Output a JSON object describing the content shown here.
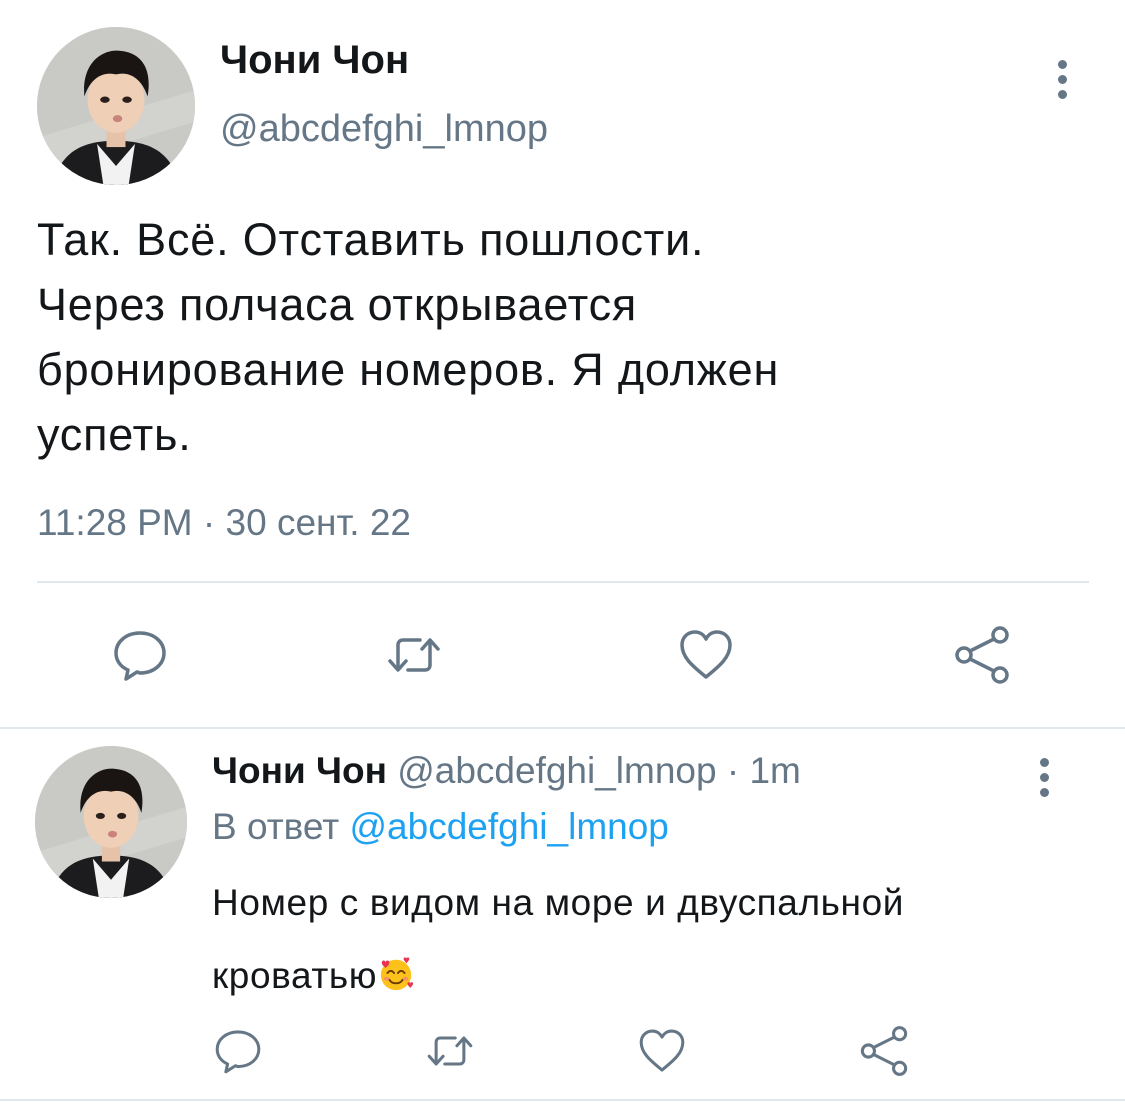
{
  "main_tweet": {
    "name": "Чони Чон",
    "handle": "@abcdefghi_lmnop",
    "text": "Так. Всё. Отставить пошлости.\nЧерез полчаса открывается\nбронирование номеров. Я должен\nуспеть.",
    "timestamp": "11:28 PM · 30 сент. 22",
    "icons": {
      "avatar": "profile-photo",
      "more": "more-vertical-icon",
      "reply": "reply-icon",
      "retweet": "retweet-icon",
      "like": "heart-icon",
      "share": "share-icon"
    }
  },
  "reply_tweet": {
    "name": "Чони Чон",
    "handle": "@abcdefghi_lmnop",
    "separator": "·",
    "time_ago": "1m",
    "reply_to_label": "В ответ",
    "reply_to_handle": "@abcdefghi_lmnop",
    "text": "Номер с видом на море и двуспальной кроватью",
    "emoji": "smiling-face-with-hearts",
    "icons": {
      "avatar": "profile-photo",
      "more": "more-vertical-icon",
      "reply": "reply-icon",
      "retweet": "retweet-icon",
      "like": "heart-icon",
      "share": "share-icon"
    }
  },
  "colors": {
    "text_primary": "#14171a",
    "text_secondary": "#657786",
    "link": "#1da1f2",
    "divider": "#e1e8ed",
    "icon": "#657786"
  }
}
